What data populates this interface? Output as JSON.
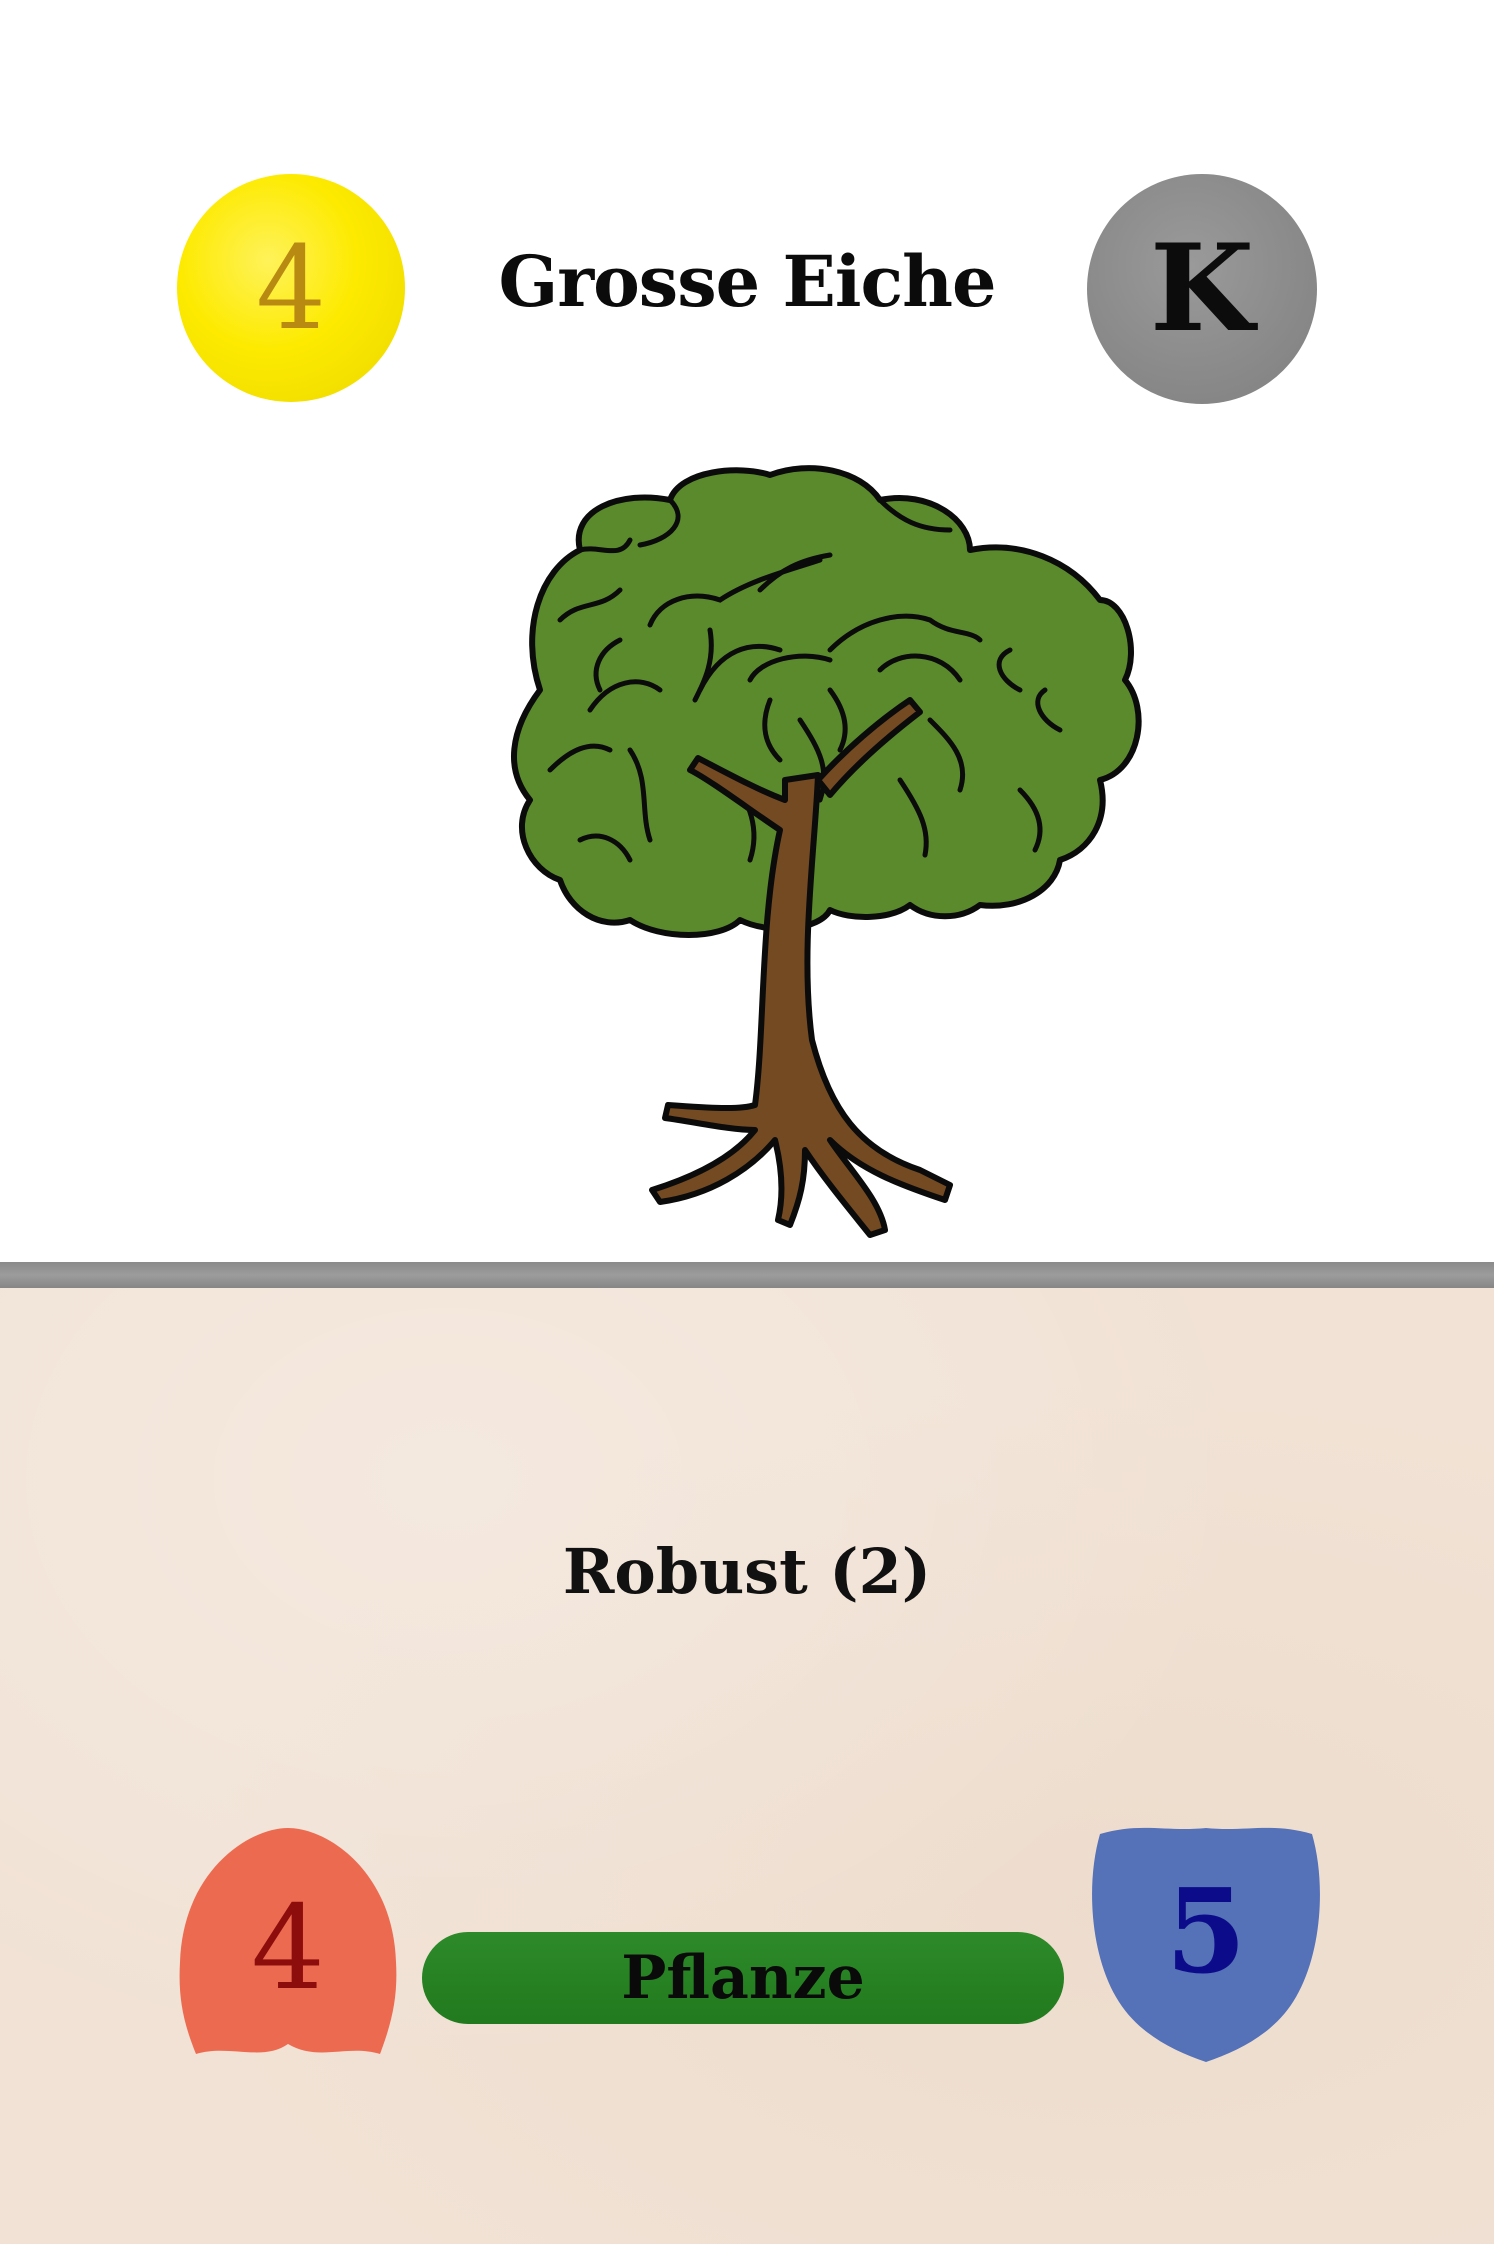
{
  "card": {
    "cost": "4",
    "type_letter": "K",
    "title": "Grosse Eiche",
    "ability": "Robust (2)",
    "attack": "4",
    "defense": "5",
    "faction": "Pflanze",
    "illustration": "oak-tree-icon"
  },
  "colors": {
    "cost_coin": "#fdea00",
    "type_coin": "#8b8b8b",
    "attack_shield": "#ec6b50",
    "defense_shield": "#5571b8",
    "faction_bar": "#278223",
    "foliage": "#5a8a2c",
    "trunk": "#744a22",
    "parchment": "#f1e2d5"
  }
}
